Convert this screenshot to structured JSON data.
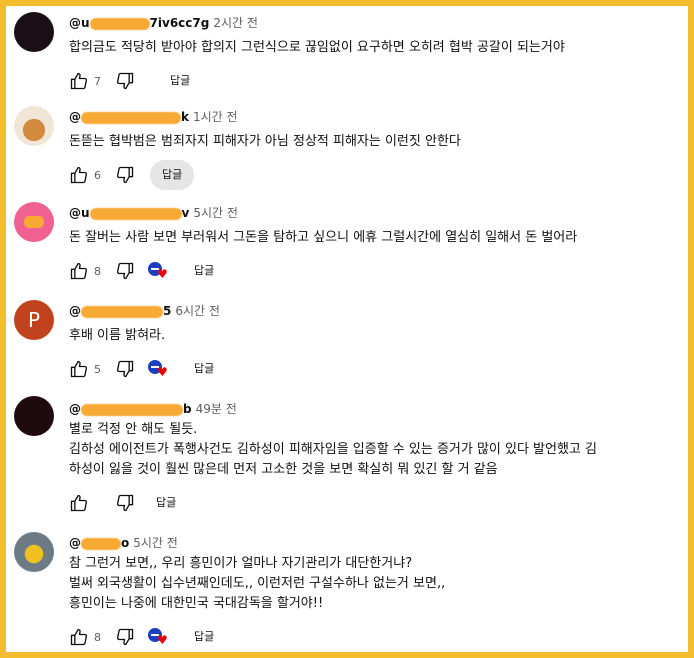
{
  "colors": {
    "frame": "#f5bc2e",
    "blur": "#f7a933",
    "heart": "#e00000",
    "creator": "#1d3fbf"
  },
  "comments": [
    {
      "handle": "@u",
      "handle_tail": "7iv6cc7g",
      "time": "2시간 전",
      "lines": [
        "합의금도 적당히 받아야 합의지 그런식으로 끊임없이 요구하면 오히려 협박 공갈이 되는거야"
      ],
      "likes": "7",
      "reply": "답글",
      "hearted": false
    },
    {
      "handle": "@",
      "handle_tail": "k",
      "time": "1시간 전",
      "lines": [
        "돈뜯는 협박범은 범죄자지 피해자가 아님 정상적 피해자는 이런짓 안한다"
      ],
      "likes": "6",
      "reply": "답글",
      "hearted": false
    },
    {
      "handle": "@u",
      "handle_tail": "v",
      "time": "5시간 전",
      "lines": [
        "돈 잘버는 사람 보면 부러워서 그돈을 탐하고 싶으니 에휴 그럴시간에 열심히 일해서 돈 벌어라"
      ],
      "likes": "8",
      "reply": "답글",
      "hearted": true
    },
    {
      "handle": "@",
      "handle_tail": "5",
      "time": "6시간 전",
      "avatar_letter": "P",
      "lines": [
        "후배 이름 밝혀라."
      ],
      "likes": "5",
      "reply": "답글",
      "hearted": true
    },
    {
      "handle": "@",
      "handle_tail": "b",
      "time": "49분 전",
      "lines": [
        "별로 걱정 안 해도 될듯.",
        "김하성 에이전트가 폭행사건도 김하성이 피해자임을 입증할 수 있는 증거가 많이 있다 발언했고 김",
        "하성이 잃을 것이 훨씬 많은데 먼저 고소한 것을 보면 확실히 뭐 있긴 할 거 같음"
      ],
      "likes": "",
      "reply": "답글",
      "hearted": false
    },
    {
      "handle": "@",
      "handle_tail": "o",
      "time": "5시간 전",
      "lines": [
        "참 그런거 보면,, 우리 흥민이가 얼마나 자기관리가 대단한거냐?",
        "벌써 외국생활이 십수년째인데도,, 이런저런  구설수하나 없는거 보면,,",
        "흥민이는 나중에 대한민국 국대감독을 할거야!!"
      ],
      "likes": "8",
      "reply": "답글",
      "hearted": true
    }
  ]
}
